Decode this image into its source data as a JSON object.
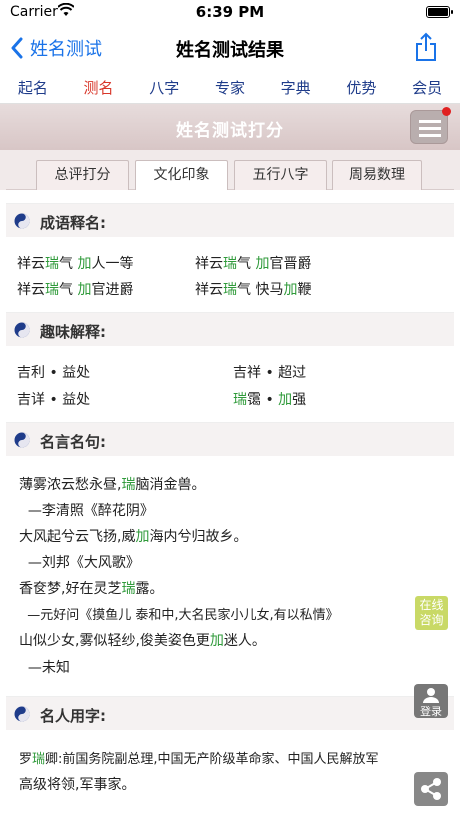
{
  "status": {
    "carrier": "Carrier",
    "time": "6:39 PM"
  },
  "nav": {
    "back_label": "姓名测试",
    "title": "姓名测试结果"
  },
  "main_tabs": [
    {
      "label": "起名"
    },
    {
      "label": "测名"
    },
    {
      "label": "八字"
    },
    {
      "label": "专家"
    },
    {
      "label": "字典"
    },
    {
      "label": "优势"
    },
    {
      "label": "会员"
    }
  ],
  "banner": {
    "title": "姓名测试打分"
  },
  "sub_tabs": [
    {
      "label": "总评打分"
    },
    {
      "label": "文化印象"
    },
    {
      "label": "五行八字"
    },
    {
      "label": "周易数理"
    }
  ],
  "sections": {
    "idiom": {
      "title": "成语释名:",
      "items": [
        {
          "a": "祥云",
          "b": "瑞",
          "c": "气 ",
          "d": "加",
          "e": "人一等"
        },
        {
          "a": "祥云",
          "b": "瑞",
          "c": "气 ",
          "d": "加",
          "e": "官晋爵"
        },
        {
          "a": "祥云",
          "b": "瑞",
          "c": "气 ",
          "d": "加",
          "e": "官进爵"
        },
        {
          "a": "祥云",
          "b": "瑞",
          "c": "气 快马",
          "d": "加",
          "e": "鞭"
        }
      ]
    },
    "fun": {
      "title": "趣味解释:",
      "items": [
        {
          "text": "吉利 • 益处"
        },
        {
          "text": "吉祥 • 超过"
        },
        {
          "text": "吉详 • 益处"
        },
        {
          "g1": "瑞",
          "m1": "霭 • ",
          "g2": "加",
          "m2": "强"
        }
      ]
    },
    "quotes": {
      "title": "名言名句:",
      "lines": [
        {
          "pre": "薄雾浓云愁永昼,",
          "g": "瑞",
          "post": "脑消金兽。"
        },
        {
          "pre": "  —李清照《醉花阴》",
          "g": "",
          "post": ""
        },
        {
          "pre": "大风起兮云飞扬,威",
          "g": "加",
          "post": "海内兮归故乡。"
        },
        {
          "pre": "  —刘邦《大风歌》",
          "g": "",
          "post": ""
        },
        {
          "pre": "香奁梦,好在灵芝",
          "g": "瑞",
          "post": "露。"
        },
        {
          "pre": "  —元好问《摸鱼儿 泰和中,大名民家小儿女,有以私情》",
          "g": "",
          "post": ""
        },
        {
          "pre": "山似少女,雾似轻纱,俊美姿色更",
          "g": "加",
          "post": "迷人。"
        },
        {
          "pre": "  —未知",
          "g": "",
          "post": ""
        }
      ]
    },
    "celebrity": {
      "title": "名人用字:",
      "line1_pre": "罗",
      "line1_g": "瑞",
      "line1_post": "卿:前国务院副总理,中国无产阶级革命家、中国人民解放军",
      "line2": "高级将领,军事家。"
    }
  },
  "floating": {
    "online": "在线咨询",
    "online_l1": "在线",
    "online_l2": "咨询",
    "login": "登录"
  },
  "colors": {
    "accent_blue": "#1a73e8",
    "active_red": "#d8362a",
    "highlight_green": "#2f9a3a",
    "tab_blue": "#1f3c8a"
  }
}
